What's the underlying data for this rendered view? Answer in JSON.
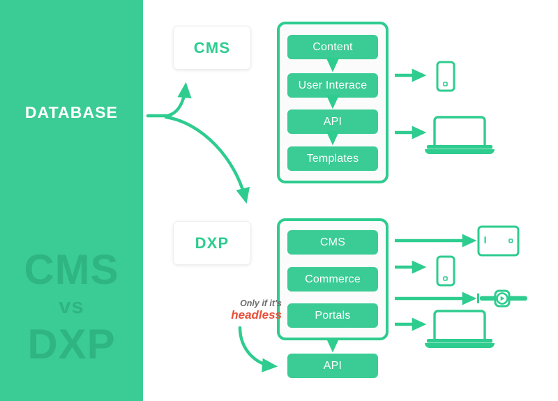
{
  "sidebar": {
    "title": "DATABASE",
    "watermark": {
      "line1": "CMS",
      "line2": "vs",
      "line3": "DXP"
    },
    "bg_color": "#3bcb94",
    "watermark_color": "#2fb582"
  },
  "labels": {
    "cms": "CMS",
    "dxp": "DXP"
  },
  "cms_stack": {
    "items": [
      {
        "label": "Content"
      },
      {
        "label": "User Interace"
      },
      {
        "label": "API"
      },
      {
        "label": "Templates"
      }
    ],
    "outputs": [
      {
        "device": "phone-icon"
      },
      {
        "device": "laptop-icon"
      }
    ]
  },
  "dxp_stack": {
    "items": [
      {
        "label": "CMS"
      },
      {
        "label": "Commerce"
      },
      {
        "label": "Portals"
      }
    ],
    "outputs": [
      {
        "device": "tablet-icon"
      },
      {
        "device": "phone-icon"
      },
      {
        "device": "smartwatch-icon"
      },
      {
        "device": "laptop-icon"
      }
    ]
  },
  "dxp_api": {
    "label": "API"
  },
  "note": {
    "line1": "Only if it's",
    "line2": "headless",
    "line1_color": "#6d6d6d",
    "line2_color": "#e8503a"
  },
  "theme": {
    "green": "#3bcb94",
    "green_border": "#2ecc8f",
    "white": "#ffffff",
    "frame_bg": "#fbfbfb"
  }
}
